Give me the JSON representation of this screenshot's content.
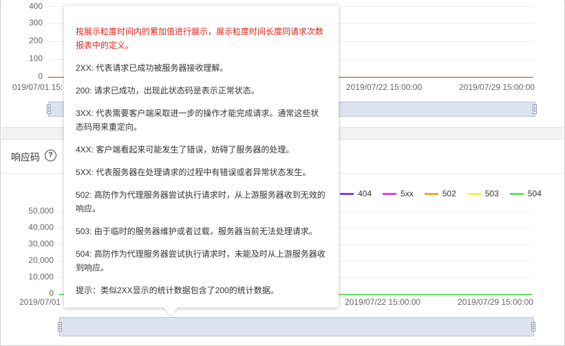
{
  "top_chart": {
    "y_ticks": [
      "400",
      "300",
      "200",
      "100",
      "0"
    ],
    "x_ticks": [
      "019/07/01 15:",
      "2019/07/22 15:00:00",
      "2019/07/29 15:00:00"
    ]
  },
  "section": {
    "title": "响应码",
    "help_icon": "question-circle-icon"
  },
  "bottom_chart": {
    "y_ticks": [
      "50,000",
      "40,000",
      "30,000",
      "20,000",
      "10,000",
      "0"
    ],
    "x_ticks": [
      "2019/07/01",
      "2019/07/22 15:00:00",
      "2019/07/29 15:00:00"
    ],
    "legend": [
      {
        "label": "404",
        "color": "#7b3fe4"
      },
      {
        "label": "5xx",
        "color": "#e040e0"
      },
      {
        "label": "502",
        "color": "#f5a623"
      },
      {
        "label": "503",
        "color": "#f5f54a"
      },
      {
        "label": "504",
        "color": "#5fe05f"
      }
    ]
  },
  "tooltip": {
    "intro": "按展示粒度时间内的累加值进行展示，展示粒度时间长度同请求次数报表中的定义。",
    "items": [
      "2XX: 代表请求已成功被服务器接收理解。",
      "200: 请求已成功，出现此状态码是表示正常状态。",
      "3XX: 代表需要客户端采取进一步的操作才能完成请求。通常这些状态码用来重定向。",
      "4XX: 客户端看起来可能发生了错误，妨碍了服务器的处理。",
      "5XX: 代表服务器在处理请求的过程中有错误或者异常状态发生。",
      "502: 高防作为代理服务器尝试执行请求时，从上游服务器收到无效的响应。",
      "503: 由于临时的服务器维护或者过载，服务器当前无法处理请求。",
      "504: 高防作为代理服务器尝试执行请求时，未能及时从上游服务器收到响应。",
      "提示：类似2XX显示的统计数据包含了200的统计数据。"
    ]
  }
}
